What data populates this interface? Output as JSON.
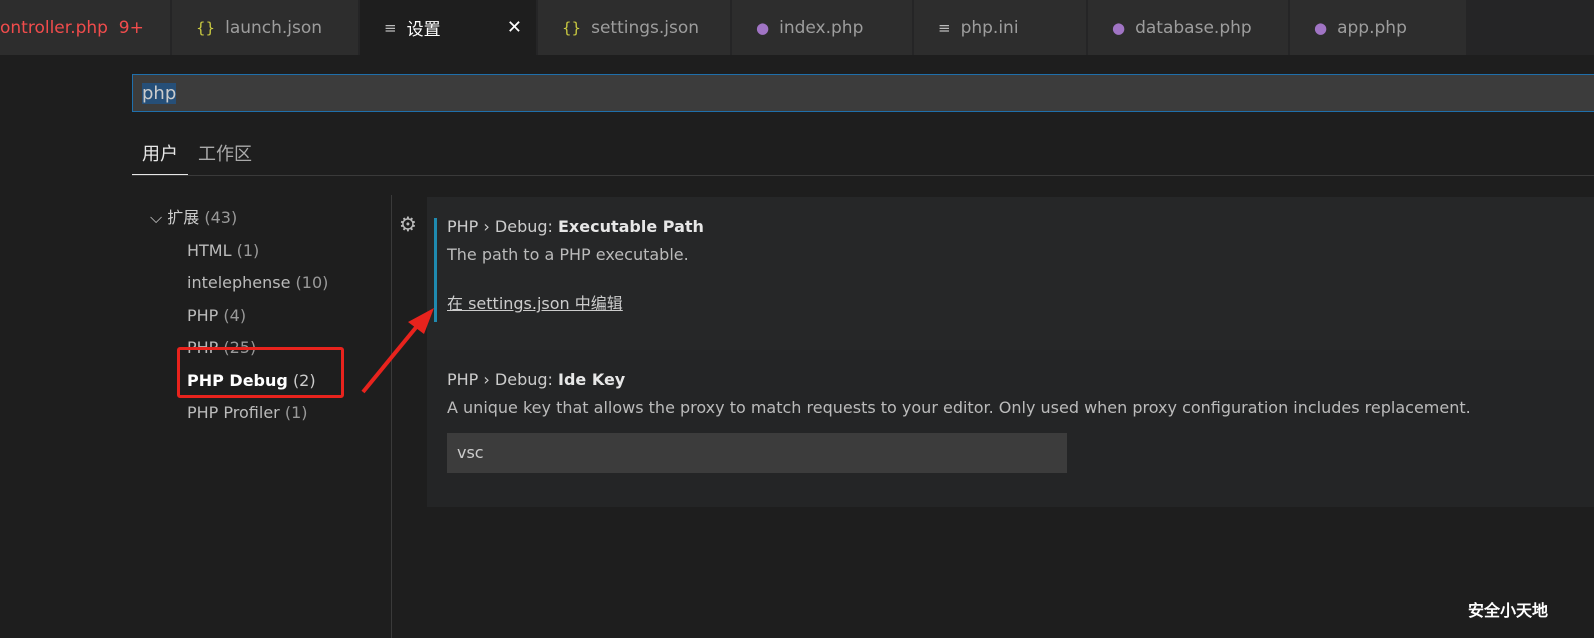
{
  "tabs": [
    {
      "label": "ontroller.php",
      "badge": "9+",
      "icon": "php-icon",
      "color": "#f14c4c"
    },
    {
      "label": "launch.json",
      "icon": "json-braces-icon"
    },
    {
      "label": "设置",
      "icon": "settings-lines-icon",
      "active": true
    },
    {
      "label": "settings.json",
      "icon": "json-braces-icon"
    },
    {
      "label": "index.php",
      "icon": "php-elephant-icon"
    },
    {
      "label": "php.ini",
      "icon": "lines-icon"
    },
    {
      "label": "database.php",
      "icon": "php-elephant-icon"
    },
    {
      "label": "app.php",
      "icon": "php-elephant-icon"
    }
  ],
  "search": {
    "value": "php"
  },
  "scopes": [
    "用户",
    "工作区"
  ],
  "tree": {
    "group": "扩展",
    "group_count": "(43)",
    "items": [
      {
        "label": "HTML",
        "count": "(1)"
      },
      {
        "label": "intelephense",
        "count": "(10)"
      },
      {
        "label": "PHP",
        "count": "(4)"
      },
      {
        "label": "PHP",
        "count": "(25)"
      },
      {
        "label": "PHP Debug",
        "count": "(2)",
        "selected": true
      },
      {
        "label": "PHP Profiler",
        "count": "(1)"
      }
    ]
  },
  "settings": [
    {
      "prefix": "PHP › Debug: ",
      "name": "Executable Path",
      "description": "The path to a PHP executable.",
      "link": "在 settings.json 中编辑"
    },
    {
      "prefix": "PHP › Debug: ",
      "name": "Ide Key",
      "description": "A unique key that allows the proxy to match requests to your editor. Only used when proxy configuration includes replacement.",
      "value": "vsc"
    }
  ],
  "watermark": "安全小天地",
  "annotation_color": "#e8231d"
}
